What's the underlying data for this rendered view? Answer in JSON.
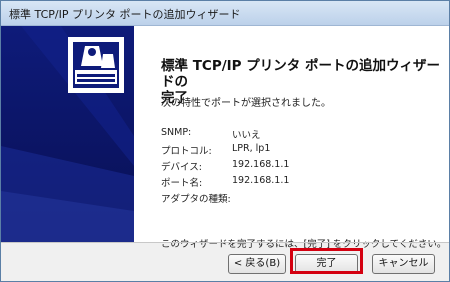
{
  "window": {
    "title": "標準 TCP/IP プリンタ ポートの追加ウィザード"
  },
  "main": {
    "heading_line1": "標準 TCP/IP プリンタ ポートの追加ウィザードの",
    "heading_line2": "完了",
    "subtitle": "次の特性でポートが選択されました。",
    "properties": [
      {
        "label": "SNMP:",
        "value": "いいえ"
      },
      {
        "label": "プロトコル:",
        "value": "LPR, lp1"
      },
      {
        "label": "デバイス:",
        "value": "192.168.1.1"
      },
      {
        "label": "ポート名:",
        "value": "192.168.1.1"
      },
      {
        "label": "アダプタの種類:",
        "value": ""
      }
    ],
    "finish_note": "このウィザードを完了するには、[完了] をクリックしてください。"
  },
  "buttons": {
    "back": "< 戻る(B)",
    "finish": "完了",
    "cancel": "キャンセル"
  },
  "colors": {
    "banner": "#0e1b7a",
    "highlight": "#d40010"
  }
}
